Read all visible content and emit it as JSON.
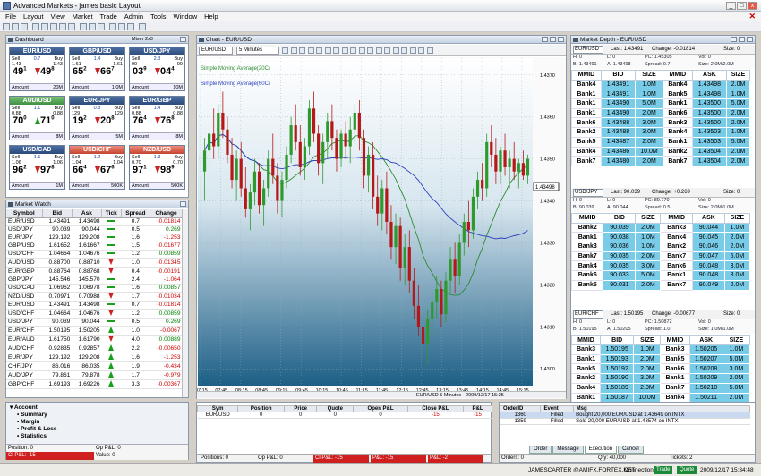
{
  "window": {
    "title": "Advanced Markets - james basic Layout"
  },
  "menu": [
    "File",
    "Layout",
    "View",
    "Market",
    "Trade",
    "Admin",
    "Tools",
    "Window",
    "Help"
  ],
  "dashboard": {
    "title": "Dashboard",
    "mode": "Mixer 2x3",
    "tiles": [
      {
        "pair": "EUR/USD",
        "sell": "1.43",
        "buy": "1.43",
        "spread": "0.7",
        "big_sell": "49",
        "sup_sell": "1",
        "big_buy": "49",
        "sup_buy": "8",
        "amount_label": "Amount",
        "amount": "20M",
        "state": "neutral"
      },
      {
        "pair": "GBP/USD",
        "sell": "1.61",
        "buy": "1.61",
        "spread": "1.4",
        "big_sell": "65",
        "sup_sell": "2",
        "big_buy": "66",
        "sup_buy": "7",
        "amount_label": "Amount",
        "amount": "1.0M",
        "state": "neutral"
      },
      {
        "pair": "USD/JPY",
        "sell": "90",
        "buy": "90",
        "spread": "2.3",
        "big_sell": "03",
        "sup_sell": "9",
        "big_buy": "04",
        "sup_buy": "4",
        "amount_label": "Amount",
        "amount": "10M",
        "state": "neutral"
      },
      {
        "pair": "AUD/USD",
        "sell": "0.88",
        "buy": "0.88",
        "spread": "1.1",
        "big_sell": "70",
        "sup_sell": "0",
        "big_buy": "71",
        "sup_buy": "0",
        "amount_label": "Amount",
        "amount": "8M",
        "state": "up"
      },
      {
        "pair": "EUR/JPY",
        "sell": "129",
        "buy": "129",
        "spread": "0.8",
        "big_sell": "19",
        "sup_sell": "2",
        "big_buy": "20",
        "sup_buy": "8",
        "amount_label": "Amount",
        "amount": "5M",
        "state": "neutral"
      },
      {
        "pair": "EUR/GBP",
        "sell": "0.88",
        "buy": "0.88",
        "spread": "1.4",
        "big_sell": "76",
        "sup_sell": "4",
        "big_buy": "76",
        "sup_buy": "8",
        "amount_label": "Amount",
        "amount": "8M",
        "state": "neutral"
      },
      {
        "pair": "USD/CAD",
        "sell": "1.06",
        "buy": "1.06",
        "spread": "1.5",
        "big_sell": "96",
        "sup_sell": "2",
        "big_buy": "97",
        "sup_buy": "8",
        "amount_label": "Amount",
        "amount": "1M",
        "state": "neutral"
      },
      {
        "pair": "USD/CHF",
        "sell": "1.04",
        "buy": "1.04",
        "spread": "1.2",
        "big_sell": "66",
        "sup_sell": "4",
        "big_buy": "67",
        "sup_buy": "6",
        "amount_label": "Amount",
        "amount": "500K",
        "state": "dn"
      },
      {
        "pair": "NZD/USD",
        "sell": "0.70",
        "buy": "0.70",
        "spread": "1.3",
        "big_sell": "97",
        "sup_sell": "1",
        "big_buy": "98",
        "sup_buy": "9",
        "amount_label": "Amount",
        "amount": "500K",
        "state": "dn"
      }
    ]
  },
  "market_watch": {
    "title": "Market Watch",
    "columns": [
      "Symbol",
      "Bid",
      "Ask",
      "Tick",
      "Spread",
      "Change"
    ],
    "rows": [
      [
        "EUR/USD",
        "1.43491",
        "1.43498",
        "-",
        "0.7",
        "-0.01814"
      ],
      [
        "USD/JPY",
        "90.039",
        "90.044",
        "-",
        "0.5",
        "0.269"
      ],
      [
        "EUR/JPY",
        "129.192",
        "129.208",
        "-",
        "1.6",
        "-1.253"
      ],
      [
        "GBP/USD",
        "1.61652",
        "1.61667",
        "-",
        "1.5",
        "-0.01677"
      ],
      [
        "USD/CHF",
        "1.04664",
        "1.04676",
        "-",
        "1.2",
        "0.00859"
      ],
      [
        "AUD/USD",
        "0.88700",
        "0.88710",
        "down",
        "1.0",
        "-0.01345"
      ],
      [
        "EUR/GBP",
        "0.88764",
        "0.88768",
        "down",
        "0.4",
        "-0.00191"
      ],
      [
        "GBP/JPY",
        "145.546",
        "145.570",
        "-",
        "2.4",
        "-1.064"
      ],
      [
        "USD/CAD",
        "1.06962",
        "1.06978",
        "-",
        "1.6",
        "0.00857"
      ],
      [
        "NZD/USD",
        "0.70971",
        "0.70988",
        "down",
        "1.7",
        "-0.01034"
      ],
      [
        "EUR/USD",
        "1.43491",
        "1.43498",
        "-",
        "0.7",
        "-0.01814"
      ],
      [
        "USD/CHF",
        "1.04664",
        "1.04676",
        "down",
        "1.2",
        "0.00859"
      ],
      [
        "USD/JPY",
        "90.039",
        "90.044",
        "-",
        "0.5",
        "0.269"
      ],
      [
        "EUR/CHF",
        "1.50195",
        "1.50205",
        "up",
        "1.0",
        "-0.0067"
      ],
      [
        "EUR/AUD",
        "1.61750",
        "1.61790",
        "down",
        "4.0",
        "0.00889"
      ],
      [
        "AUD/CHF",
        "0.92835",
        "0.92857",
        "up",
        "2.2",
        "-0.00650"
      ],
      [
        "EUR/JPY",
        "129.192",
        "129.208",
        "up",
        "1.6",
        "-1.253"
      ],
      [
        "CHF/JPY",
        "86.016",
        "86.035",
        "up",
        "1.9",
        "-0.434"
      ],
      [
        "AUD/JPY",
        "79.861",
        "79.878",
        "up",
        "1.7",
        "-0.979"
      ],
      [
        "GBP/CHF",
        "1.69193",
        "1.69226",
        "up",
        "3.3",
        "-0.00367"
      ]
    ]
  },
  "account": {
    "items": [
      "Account",
      "Summary",
      "Margin",
      "Profit & Loss",
      "Statistics"
    ],
    "position_label": "Position: 0",
    "op_pl_label": "Op P&L: 0",
    "cl_pl_label": "Cl P&L: -15",
    "value_label": "Value: 0"
  },
  "chart": {
    "title": "Chart - EUR/USD",
    "symbol": "EUR/USD",
    "interval": "5 Minutes",
    "legend": [
      "Simple Moving Average(20C)",
      "Simple Moving Average(60C)"
    ],
    "price_label": "1.43498",
    "bottom_status": "EUR/USD 5 Minutes - 2009/12/17 15:25"
  },
  "chart_data": {
    "type": "candlestick",
    "x_ticks": [
      "07:15",
      "07:45",
      "08:15",
      "08:45",
      "09:15",
      "09:45",
      "10:15",
      "10:45",
      "11:15",
      "11:45",
      "12:15",
      "12:45",
      "13:15",
      "13:45",
      "14:15",
      "14:45",
      "15:15"
    ],
    "y_ticks": [
      "1.4370",
      "1.4360",
      "1.4350",
      "1.4340",
      "1.4330",
      "1.4320",
      "1.4310",
      "1.4300"
    ],
    "ylim": [
      1.4296,
      1.4374
    ],
    "series": [
      {
        "name": "Simple Moving Average(20C)",
        "color": "#2e8b2e"
      },
      {
        "name": "Simple Moving Average(60C)",
        "color": "#2a3fbf"
      }
    ],
    "candles": [
      [
        1.4347,
        1.4355,
        1.434,
        1.4352
      ],
      [
        1.4352,
        1.4358,
        1.4348,
        1.4356
      ],
      [
        1.4356,
        1.4362,
        1.435,
        1.4353
      ],
      [
        1.4353,
        1.4363,
        1.435,
        1.4361
      ],
      [
        1.4361,
        1.4366,
        1.4355,
        1.4357
      ],
      [
        1.4357,
        1.436,
        1.4349,
        1.4351
      ],
      [
        1.4351,
        1.4355,
        1.4343,
        1.4345
      ],
      [
        1.4345,
        1.4352,
        1.434,
        1.435
      ],
      [
        1.435,
        1.4354,
        1.4341,
        1.4343
      ],
      [
        1.4343,
        1.4348,
        1.4336,
        1.4338
      ],
      [
        1.4338,
        1.4344,
        1.4333,
        1.4342
      ],
      [
        1.4342,
        1.435,
        1.4339,
        1.4347
      ],
      [
        1.4347,
        1.4349,
        1.4337,
        1.4339
      ],
      [
        1.4339,
        1.4345,
        1.4334,
        1.4343
      ],
      [
        1.4343,
        1.4352,
        1.4341,
        1.435
      ],
      [
        1.435,
        1.4356,
        1.4344,
        1.4346
      ],
      [
        1.4346,
        1.4349,
        1.4337,
        1.434
      ],
      [
        1.434,
        1.4347,
        1.4336,
        1.4345
      ],
      [
        1.4345,
        1.4353,
        1.4343,
        1.4351
      ],
      [
        1.4351,
        1.436,
        1.4349,
        1.4358
      ],
      [
        1.4358,
        1.4363,
        1.4352,
        1.4354
      ],
      [
        1.4354,
        1.4358,
        1.4346,
        1.4348
      ],
      [
        1.4348,
        1.4355,
        1.4345,
        1.4353
      ],
      [
        1.4353,
        1.4364,
        1.4351,
        1.4362
      ],
      [
        1.4362,
        1.4366,
        1.4354,
        1.4356
      ],
      [
        1.4356,
        1.4358,
        1.4346,
        1.4349
      ],
      [
        1.4349,
        1.4356,
        1.4344,
        1.4354
      ],
      [
        1.4354,
        1.4361,
        1.435,
        1.4359
      ],
      [
        1.4359,
        1.4363,
        1.4352,
        1.4355
      ],
      [
        1.4355,
        1.4357,
        1.4347,
        1.435
      ],
      [
        1.435,
        1.4357,
        1.4348,
        1.4356
      ],
      [
        1.4356,
        1.4359,
        1.435,
        1.4353
      ],
      [
        1.4353,
        1.436,
        1.4349,
        1.4357
      ],
      [
        1.4357,
        1.4363,
        1.4354,
        1.4361
      ],
      [
        1.4361,
        1.4364,
        1.4352,
        1.4355
      ],
      [
        1.4355,
        1.4357,
        1.4343,
        1.4346
      ],
      [
        1.4346,
        1.4353,
        1.4342,
        1.4351
      ],
      [
        1.4351,
        1.4354,
        1.4338,
        1.4341
      ],
      [
        1.4341,
        1.4346,
        1.4334,
        1.4337
      ],
      [
        1.4337,
        1.4345,
        1.4333,
        1.4343
      ],
      [
        1.4343,
        1.4347,
        1.4332,
        1.4335
      ],
      [
        1.4335,
        1.4339,
        1.4326,
        1.4329
      ],
      [
        1.4329,
        1.4337,
        1.4325,
        1.4334
      ],
      [
        1.4334,
        1.4336,
        1.4321,
        1.4324
      ],
      [
        1.4324,
        1.4332,
        1.432,
        1.4329
      ],
      [
        1.4329,
        1.4333,
        1.4318,
        1.4321
      ],
      [
        1.4321,
        1.4324,
        1.4312,
        1.4315
      ],
      [
        1.4315,
        1.432,
        1.4308,
        1.431
      ],
      [
        1.431,
        1.4316,
        1.4303,
        1.4306
      ],
      [
        1.4306,
        1.4314,
        1.4301,
        1.4312
      ],
      [
        1.4312,
        1.4318,
        1.4308,
        1.4316
      ],
      [
        1.4316,
        1.4322,
        1.4312,
        1.4319
      ],
      [
        1.4319,
        1.4321,
        1.431,
        1.4313
      ],
      [
        1.4313,
        1.4323,
        1.4311,
        1.4321
      ],
      [
        1.4321,
        1.4329,
        1.4318,
        1.4326
      ],
      [
        1.4326,
        1.433,
        1.4318,
        1.4322
      ],
      [
        1.4322,
        1.4332,
        1.432,
        1.433
      ],
      [
        1.433,
        1.4337,
        1.4327,
        1.4335
      ],
      [
        1.4335,
        1.434,
        1.4329,
        1.4333
      ],
      [
        1.4333,
        1.4343,
        1.4331,
        1.4341
      ],
      [
        1.4341,
        1.4347,
        1.4338,
        1.4345
      ],
      [
        1.4345,
        1.4349,
        1.434,
        1.4343
      ],
      [
        1.4343,
        1.4356,
        1.4341,
        1.4354
      ],
      [
        1.4354,
        1.4358,
        1.4348,
        1.4351
      ],
      [
        1.4351,
        1.4355,
        1.4344,
        1.4347
      ],
      [
        1.4347,
        1.4353,
        1.4344,
        1.4352
      ],
      [
        1.4352,
        1.4356,
        1.4346,
        1.4348
      ],
      [
        1.4348,
        1.4352,
        1.4343,
        1.435
      ],
      [
        1.435,
        1.4354,
        1.4345,
        1.4347
      ],
      [
        1.4347,
        1.435,
        1.4343,
        1.4349
      ],
      [
        1.4349,
        1.4352,
        1.4345,
        1.4346
      ],
      [
        1.4346,
        1.4351,
        1.4344,
        1.435
      ]
    ]
  },
  "depth": {
    "title": "Market Depth - EUR/USD",
    "columns": [
      "MMID",
      "BID",
      "SIZE",
      "MMID",
      "ASK",
      "SIZE"
    ],
    "blocks": [
      {
        "symbol": "EUR/USD",
        "last": "Last: 1.43491",
        "change": "Change: -0.01814",
        "size": "Size: 0",
        "info": [
          "H: 0",
          "L: 0",
          "PC: 1.45305",
          "Vol: 0",
          "B: 1.43491",
          "A: 1.43498",
          "Spread: 0.7",
          "Size: 2.0M/2.0M"
        ],
        "rows": [
          [
            "Bank4",
            "1.43491",
            "1.0M",
            "Bank4",
            "1.43498",
            "2.0M"
          ],
          [
            "Bank1",
            "1.43491",
            "1.0M",
            "Bank5",
            "1.43498",
            "1.0M"
          ],
          [
            "Bank1",
            "1.43490",
            "5.0M",
            "Bank1",
            "1.43500",
            "5.0M"
          ],
          [
            "Bank1",
            "1.43490",
            "2.0M",
            "Bank6",
            "1.43500",
            "2.0M"
          ],
          [
            "Bank6",
            "1.43488",
            "3.0M",
            "Bank3",
            "1.43500",
            "2.0M"
          ],
          [
            "Bank2",
            "1.43488",
            "3.0M",
            "Bank4",
            "1.43503",
            "1.0M"
          ],
          [
            "Bank5",
            "1.43487",
            "2.0M",
            "Bank1",
            "1.43503",
            "5.0M"
          ],
          [
            "Bank4",
            "1.43486",
            "10.0M",
            "Bank2",
            "1.43504",
            "2.0M"
          ],
          [
            "Bank7",
            "1.43480",
            "2.0M",
            "Bank7",
            "1.43504",
            "2.0M"
          ]
        ]
      },
      {
        "symbol": "USD/JPY",
        "last": "Last: 90.039",
        "change": "Change: +0.269",
        "size": "Size: 0",
        "info": [
          "H: 0",
          "L: 0",
          "PC: 89.770",
          "Vol: 0",
          "B: 90.039",
          "A: 90.044",
          "Spread: 0.5",
          "Size: 2.0M/1.0M"
        ],
        "rows": [
          [
            "Bank2",
            "90.039",
            "2.0M",
            "Bank3",
            "90.044",
            "1.0M"
          ],
          [
            "Bank1",
            "90.038",
            "1.0M",
            "Bank4",
            "90.045",
            "2.0M"
          ],
          [
            "Bank3",
            "90.036",
            "1.0M",
            "Bank2",
            "90.046",
            "2.0M"
          ],
          [
            "Bank7",
            "90.035",
            "2.0M",
            "Bank7",
            "90.047",
            "5.0M"
          ],
          [
            "Bank4",
            "90.035",
            "3.0M",
            "Bank6",
            "90.048",
            "3.0M"
          ],
          [
            "Bank6",
            "90.033",
            "5.0M",
            "Bank1",
            "90.048",
            "3.0M"
          ],
          [
            "Bank5",
            "90.031",
            "2.0M",
            "Bank7",
            "90.049",
            "2.0M"
          ]
        ]
      },
      {
        "symbol": "EUR/CHF",
        "last": "Last: 1.50195",
        "change": "Change: -0.00677",
        "size": "Size: 0",
        "info": [
          "H: 0",
          "L: 0",
          "PC: 1.50872",
          "Vol: 0",
          "B: 1.50195",
          "A: 1.50205",
          "Spread: 1.0",
          "Size: 1.0M/1.0M"
        ],
        "rows": [
          [
            "Bank3",
            "1.50195",
            "1.0M",
            "Bank3",
            "1.50205",
            "1.0M"
          ],
          [
            "Bank1",
            "1.50193",
            "2.0M",
            "Bank5",
            "1.50207",
            "5.0M"
          ],
          [
            "Bank5",
            "1.50192",
            "2.0M",
            "Bank6",
            "1.50208",
            "3.0M"
          ],
          [
            "Bank2",
            "1.50190",
            "3.0M",
            "Bank1",
            "1.50209",
            "2.0M"
          ],
          [
            "Bank4",
            "1.50189",
            "2.0M",
            "Bank7",
            "1.50210",
            "5.0M"
          ],
          [
            "Bank1",
            "1.50187",
            "10.0M",
            "Bank4",
            "1.50211",
            "2.0M"
          ],
          [
            "Bank7",
            "1.50182",
            "5.0M",
            "Bank2",
            "1.50214",
            "10.0M"
          ]
        ]
      }
    ]
  },
  "positions": {
    "columns": [
      "Sym",
      "Position",
      "Price",
      "Quote",
      "Open P&L",
      "Close P&L",
      "P&L"
    ],
    "rows": [
      [
        "EUR/USD",
        "0",
        "0",
        "0",
        "0",
        "-15",
        "-15"
      ]
    ],
    "footer": [
      "Positions: 0",
      "Op P&L: 0",
      "Cl P&L: -15",
      "P&L: -15",
      "P&L: -2"
    ]
  },
  "orders": {
    "columns": [
      "OrderID",
      "Event",
      "Msg"
    ],
    "rows": [
      [
        "1360",
        "Filled",
        "Bought 20,000 EUR/USD at 1.43649 on INTX"
      ],
      [
        "1359",
        "Filled",
        "Sold 20,000 EUR/USD at 1.43574 on INTX"
      ]
    ],
    "tabs": [
      "Order",
      "Message",
      "Execution",
      "Cancel"
    ],
    "footer": [
      "Orders: 0",
      "Qty: 40,000",
      "Tickets: 2"
    ]
  },
  "status": {
    "user": "JAMESCARTER @AMIFX.FORTEX.NET",
    "connections_label": "Connections:",
    "trade": "Trade",
    "quote": "Quote",
    "datetime": "2009/12/17 15:34:48"
  }
}
